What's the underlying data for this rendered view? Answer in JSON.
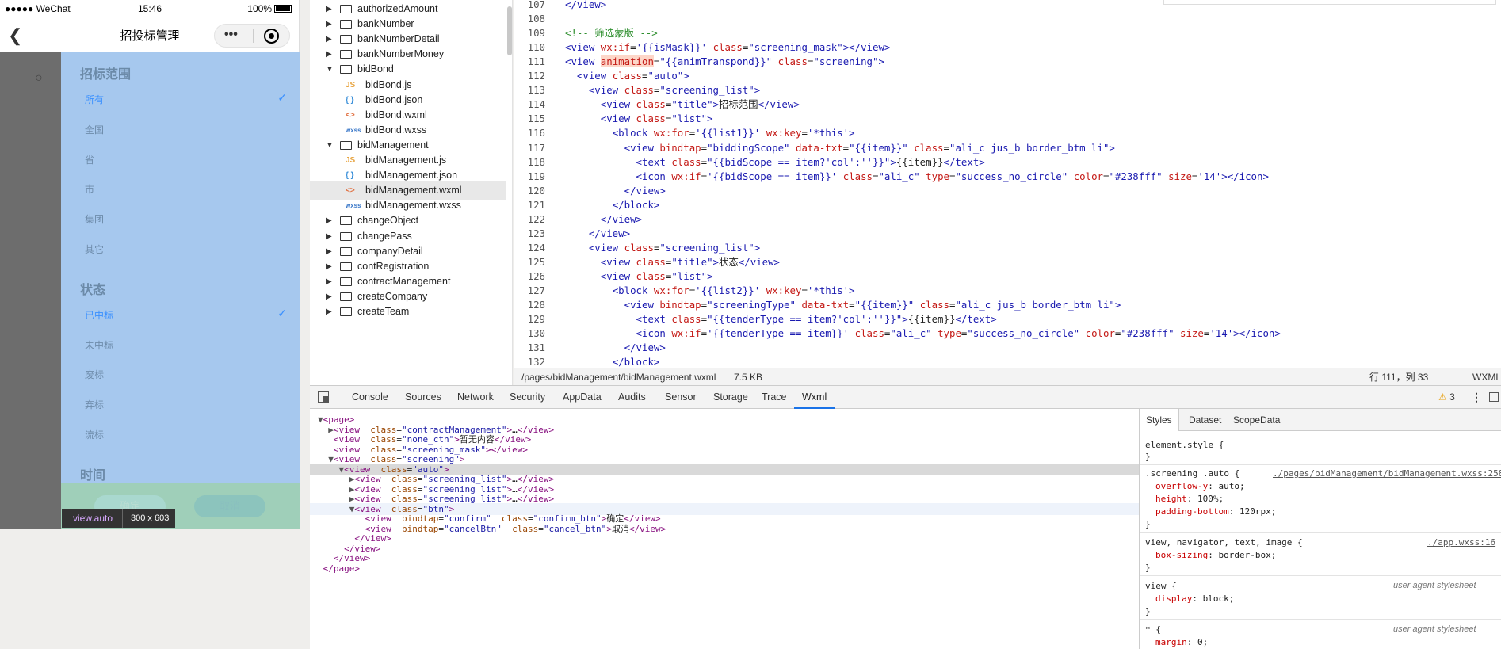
{
  "phone": {
    "statusbar": {
      "carrier": "●●●●● WeChat",
      "time": "15:46",
      "battery": "100%"
    },
    "navbar": {
      "back": "❮",
      "title": "招投标管理",
      "menu": "•••"
    },
    "sections": [
      {
        "title": "招标范围",
        "items": [
          {
            "label": "所有",
            "selected": true
          },
          {
            "label": "全国"
          },
          {
            "label": "省"
          },
          {
            "label": "市"
          },
          {
            "label": "集团"
          },
          {
            "label": "其它"
          }
        ]
      },
      {
        "title": "状态",
        "items": [
          {
            "label": "已中标",
            "selected": true
          },
          {
            "label": "未中标"
          },
          {
            "label": "废标"
          },
          {
            "label": "弃标"
          },
          {
            "label": "流标"
          }
        ]
      },
      {
        "title": "时间",
        "items": []
      }
    ],
    "check": "✓",
    "buttons": {
      "confirm": "确定",
      "cancel": "取消"
    },
    "inspect_tip": {
      "tag": "view.auto",
      "size": "300 x 603"
    }
  },
  "filetree": [
    {
      "type": "folder",
      "name": "authorizedAmount",
      "open": false,
      "depth": 0
    },
    {
      "type": "folder",
      "name": "bankNumber",
      "open": false,
      "depth": 0
    },
    {
      "type": "folder",
      "name": "bankNumberDetail",
      "open": false,
      "depth": 0
    },
    {
      "type": "folder",
      "name": "bankNumberMoney",
      "open": false,
      "depth": 0
    },
    {
      "type": "folder",
      "name": "bidBond",
      "open": true,
      "depth": 0
    },
    {
      "type": "js",
      "icon": "JS",
      "name": "bidBond.js",
      "depth": 1
    },
    {
      "type": "json",
      "icon": "{ }",
      "name": "bidBond.json",
      "depth": 1
    },
    {
      "type": "wxml",
      "icon": "<>",
      "name": "bidBond.wxml",
      "depth": 1
    },
    {
      "type": "wxss",
      "icon": "wxss",
      "name": "bidBond.wxss",
      "depth": 1
    },
    {
      "type": "folder",
      "name": "bidManagement",
      "open": true,
      "depth": 0
    },
    {
      "type": "js",
      "icon": "JS",
      "name": "bidManagement.js",
      "depth": 1
    },
    {
      "type": "json",
      "icon": "{ }",
      "name": "bidManagement.json",
      "depth": 1
    },
    {
      "type": "wxml",
      "icon": "<>",
      "name": "bidManagement.wxml",
      "depth": 1,
      "active": true
    },
    {
      "type": "wxss",
      "icon": "wxss",
      "name": "bidManagement.wxss",
      "depth": 1
    },
    {
      "type": "folder",
      "name": "changeObject",
      "open": false,
      "depth": 0
    },
    {
      "type": "folder",
      "name": "changePass",
      "open": false,
      "depth": 0
    },
    {
      "type": "folder",
      "name": "companyDetail",
      "open": false,
      "depth": 0
    },
    {
      "type": "folder",
      "name": "contRegistration",
      "open": false,
      "depth": 0
    },
    {
      "type": "folder",
      "name": "contractManagement",
      "open": false,
      "depth": 0
    },
    {
      "type": "folder",
      "name": "createCompany",
      "open": false,
      "depth": 0
    },
    {
      "type": "folder",
      "name": "createTeam",
      "open": false,
      "depth": 0
    }
  ],
  "editor": {
    "lines": [
      {
        "n": "107",
        "html": "<span class='tg'>&lt;/view&gt;</span>"
      },
      {
        "n": "108",
        "html": ""
      },
      {
        "n": "109",
        "html": "<span class='cm'>&lt;!-- 筛选蒙版 --&gt;</span>"
      },
      {
        "n": "110",
        "html": "<span class='tg'>&lt;view</span> <span class='at'>wx:if</span>=<span class='st'>'{{isMask}}'</span> <span class='at'>class</span>=<span class='st'>\"screening_mask\"</span><span class='tg'>&gt;&lt;/view&gt;</span>"
      },
      {
        "n": "111",
        "html": "<span class='tg'>&lt;view</span> <span class='hl'>animation</span>=<span class='st'>\"{{animTranspond}}\"</span> <span class='at'>class</span>=<span class='st'>\"screening\"</span><span class='tg'>&gt;</span>"
      },
      {
        "n": "112",
        "html": "  <span class='tg'>&lt;view</span> <span class='at'>class</span>=<span class='st'>\"auto\"</span><span class='tg'>&gt;</span>"
      },
      {
        "n": "113",
        "html": "    <span class='tg'>&lt;view</span> <span class='at'>class</span>=<span class='st'>\"screening_list\"</span><span class='tg'>&gt;</span>"
      },
      {
        "n": "114",
        "html": "      <span class='tg'>&lt;view</span> <span class='at'>class</span>=<span class='st'>\"title\"</span><span class='tg'>&gt;</span>招标范围<span class='tg'>&lt;/view&gt;</span>"
      },
      {
        "n": "115",
        "html": "      <span class='tg'>&lt;view</span> <span class='at'>class</span>=<span class='st'>\"list\"</span><span class='tg'>&gt;</span>"
      },
      {
        "n": "116",
        "html": "        <span class='tg'>&lt;block</span> <span class='at'>wx:for</span>=<span class='st'>'{{list1}}'</span> <span class='at'>wx:key</span>=<span class='st'>'*this'</span><span class='tg'>&gt;</span>"
      },
      {
        "n": "117",
        "html": "          <span class='tg'>&lt;view</span> <span class='at'>bindtap</span>=<span class='st'>\"biddingScope\"</span> <span class='at'>data-txt</span>=<span class='st'>\"{{item}}\"</span> <span class='at'>class</span>=<span class='st'>\"ali_c jus_b border_btm li\"</span><span class='tg'>&gt;</span>"
      },
      {
        "n": "118",
        "html": "            <span class='tg'>&lt;text</span> <span class='at'>class</span>=<span class='st'>\"{{bidScope == item?'col':''}}\"</span><span class='tg'>&gt;</span>{{item}}<span class='tg'>&lt;/text&gt;</span>"
      },
      {
        "n": "119",
        "html": "            <span class='tg'>&lt;icon</span> <span class='at'>wx:if</span>=<span class='st'>'{{bidScope == item}}'</span> <span class='at'>class</span>=<span class='st'>\"ali_c\"</span> <span class='at'>type</span>=<span class='st'>\"success_no_circle\"</span> <span class='at'>color</span>=<span class='st'>\"#238fff\"</span> <span class='at'>size</span>=<span class='st'>'14'</span><span class='tg'>&gt;&lt;/icon&gt;</span>"
      },
      {
        "n": "120",
        "html": "          <span class='tg'>&lt;/view&gt;</span>"
      },
      {
        "n": "121",
        "html": "        <span class='tg'>&lt;/block&gt;</span>"
      },
      {
        "n": "122",
        "html": "      <span class='tg'>&lt;/view&gt;</span>"
      },
      {
        "n": "123",
        "html": "    <span class='tg'>&lt;/view&gt;</span>"
      },
      {
        "n": "124",
        "html": "    <span class='tg'>&lt;view</span> <span class='at'>class</span>=<span class='st'>\"screening_list\"</span><span class='tg'>&gt;</span>"
      },
      {
        "n": "125",
        "html": "      <span class='tg'>&lt;view</span> <span class='at'>class</span>=<span class='st'>\"title\"</span><span class='tg'>&gt;</span>状态<span class='tg'>&lt;/view&gt;</span>"
      },
      {
        "n": "126",
        "html": "      <span class='tg'>&lt;view</span> <span class='at'>class</span>=<span class='st'>\"list\"</span><span class='tg'>&gt;</span>"
      },
      {
        "n": "127",
        "html": "        <span class='tg'>&lt;block</span> <span class='at'>wx:for</span>=<span class='st'>'{{list2}}'</span> <span class='at'>wx:key</span>=<span class='st'>'*this'</span><span class='tg'>&gt;</span>"
      },
      {
        "n": "128",
        "html": "          <span class='tg'>&lt;view</span> <span class='at'>bindtap</span>=<span class='st'>\"screeningType\"</span> <span class='at'>data-txt</span>=<span class='st'>\"{{item}}\"</span> <span class='at'>class</span>=<span class='st'>\"ali_c jus_b border_btm li\"</span><span class='tg'>&gt;</span>"
      },
      {
        "n": "129",
        "html": "            <span class='tg'>&lt;text</span> <span class='at'>class</span>=<span class='st'>\"{{tenderType == item?'col':''}}\"</span><span class='tg'>&gt;</span>{{item}}<span class='tg'>&lt;/text&gt;</span>"
      },
      {
        "n": "130",
        "html": "            <span class='tg'>&lt;icon</span> <span class='at'>wx:if</span>=<span class='st'>'{{tenderType == item}}'</span> <span class='at'>class</span>=<span class='st'>\"ali_c\"</span> <span class='at'>type</span>=<span class='st'>\"success_no_circle\"</span> <span class='at'>color</span>=<span class='st'>\"#238fff\"</span> <span class='at'>size</span>=<span class='st'>'14'</span><span class='tg'>&gt;&lt;/icon&gt;</span>"
      },
      {
        "n": "131",
        "html": "          <span class='tg'>&lt;/view&gt;</span>"
      },
      {
        "n": "132",
        "html": "        <span class='tg'>&lt;/block&gt;</span>"
      }
    ],
    "status": {
      "path": "/pages/bidManagement/bidManagement.wxml",
      "size": "7.5 KB",
      "position": "行 111，列 33",
      "language": "WXML"
    }
  },
  "devtools": {
    "tabs": [
      "Console",
      "Sources",
      "Network",
      "Security",
      "AppData",
      "Audits",
      "Sensor",
      "Storage",
      "Trace",
      "Wxml"
    ],
    "active_tab": "Wxml",
    "warnings": "3",
    "tree": [
      {
        "html": "<span class='tri'>▼</span><span class='tn'>&lt;page&gt;</span>"
      },
      {
        "html": "  <span class='tri'>▶</span><span class='tn'>&lt;view</span>  <span class='an'>class</span>=<span class='av'>\"contractManagement\"</span><span class='tn'>&gt;</span>…<span class='tn'>&lt;/view&gt;</span>"
      },
      {
        "html": "   <span class='tn'>&lt;view</span>  <span class='an'>class</span>=<span class='av'>\"none_ctn\"</span><span class='tn'>&gt;</span>暂无内容<span class='tn'>&lt;/view&gt;</span>"
      },
      {
        "html": "   <span class='tn'>&lt;view</span>  <span class='an'>class</span>=<span class='av'>\"screening_mask\"</span><span class='tn'>&gt;&lt;/view&gt;</span>"
      },
      {
        "html": "  <span class='tri'>▼</span><span class='tn'>&lt;view</span>  <span class='an'>class</span>=<span class='av'>\"screening\"</span><span class='tn'>&gt;</span>"
      },
      {
        "html": "    <span class='tri'>▼</span><span class='tn'>&lt;view</span>  <span class='an'>class</span>=<span class='av'>\"auto\"</span><span class='tn'>&gt;</span>",
        "sel": true
      },
      {
        "html": "      <span class='tri'>▶</span><span class='tn'>&lt;view</span>  <span class='an'>class</span>=<span class='av'>\"screening_list\"</span><span class='tn'>&gt;</span>…<span class='tn'>&lt;/view&gt;</span>"
      },
      {
        "html": "      <span class='tri'>▶</span><span class='tn'>&lt;view</span>  <span class='an'>class</span>=<span class='av'>\"screening_list\"</span><span class='tn'>&gt;</span>…<span class='tn'>&lt;/view&gt;</span>"
      },
      {
        "html": "      <span class='tri'>▶</span><span class='tn'>&lt;view</span>  <span class='an'>class</span>=<span class='av'>\"screening_list\"</span><span class='tn'>&gt;</span>…<span class='tn'>&lt;/view&gt;</span>"
      },
      {
        "html": "      <span class='tri'>▼</span><span class='tn'>&lt;view</span>  <span class='an'>class</span>=<span class='av'>\"btn\"</span><span class='tn'>&gt;</span>",
        "hov": true
      },
      {
        "html": "         <span class='tn'>&lt;view</span>  <span class='an'>bindtap</span>=<span class='av'>\"confirm\"</span>  <span class='an'>class</span>=<span class='av'>\"confirm_btn\"</span><span class='tn'>&gt;</span>确定<span class='tn'>&lt;/view&gt;</span>"
      },
      {
        "html": "         <span class='tn'>&lt;view</span>  <span class='an'>bindtap</span>=<span class='av'>\"cancelBtn\"</span>  <span class='an'>class</span>=<span class='av'>\"cancel_btn\"</span><span class='tn'>&gt;</span>取消<span class='tn'>&lt;/view&gt;</span>"
      },
      {
        "html": "       <span class='tn'>&lt;/view&gt;</span>"
      },
      {
        "html": "     <span class='tn'>&lt;/view&gt;</span>"
      },
      {
        "html": "   <span class='tn'>&lt;/view&gt;</span>"
      },
      {
        "html": " <span class='tn'>&lt;/page&gt;</span>"
      }
    ],
    "styles_tabs": [
      "Styles",
      "Dataset",
      "ScopeData"
    ],
    "styles": {
      "element_style": "element.style {",
      "close": "}",
      "rule1_sel": ".screening .auto {",
      "rule1_src": "./pages/bidManagement/bidManagement.wxss:258",
      "rule1_p1": "overflow-y",
      "rule1_v1": ": auto;",
      "rule1_p2": "height",
      "rule1_v2": ": 100%;",
      "rule1_p3": "padding-bottom",
      "rule1_v3": ": 120rpx;",
      "rule2_sel": "view, navigator, text, image {",
      "rule2_src": "./app.wxss:16",
      "rule2_p1": "box-sizing",
      "rule2_v1": ": border-box;",
      "rule3_sel": "view {",
      "ua": "user agent stylesheet",
      "rule3_p1": "display",
      "rule3_v1": ": block;",
      "rule4_sel": "* {",
      "rule4_p1": "margin",
      "rule4_v1": ": 0;"
    }
  }
}
